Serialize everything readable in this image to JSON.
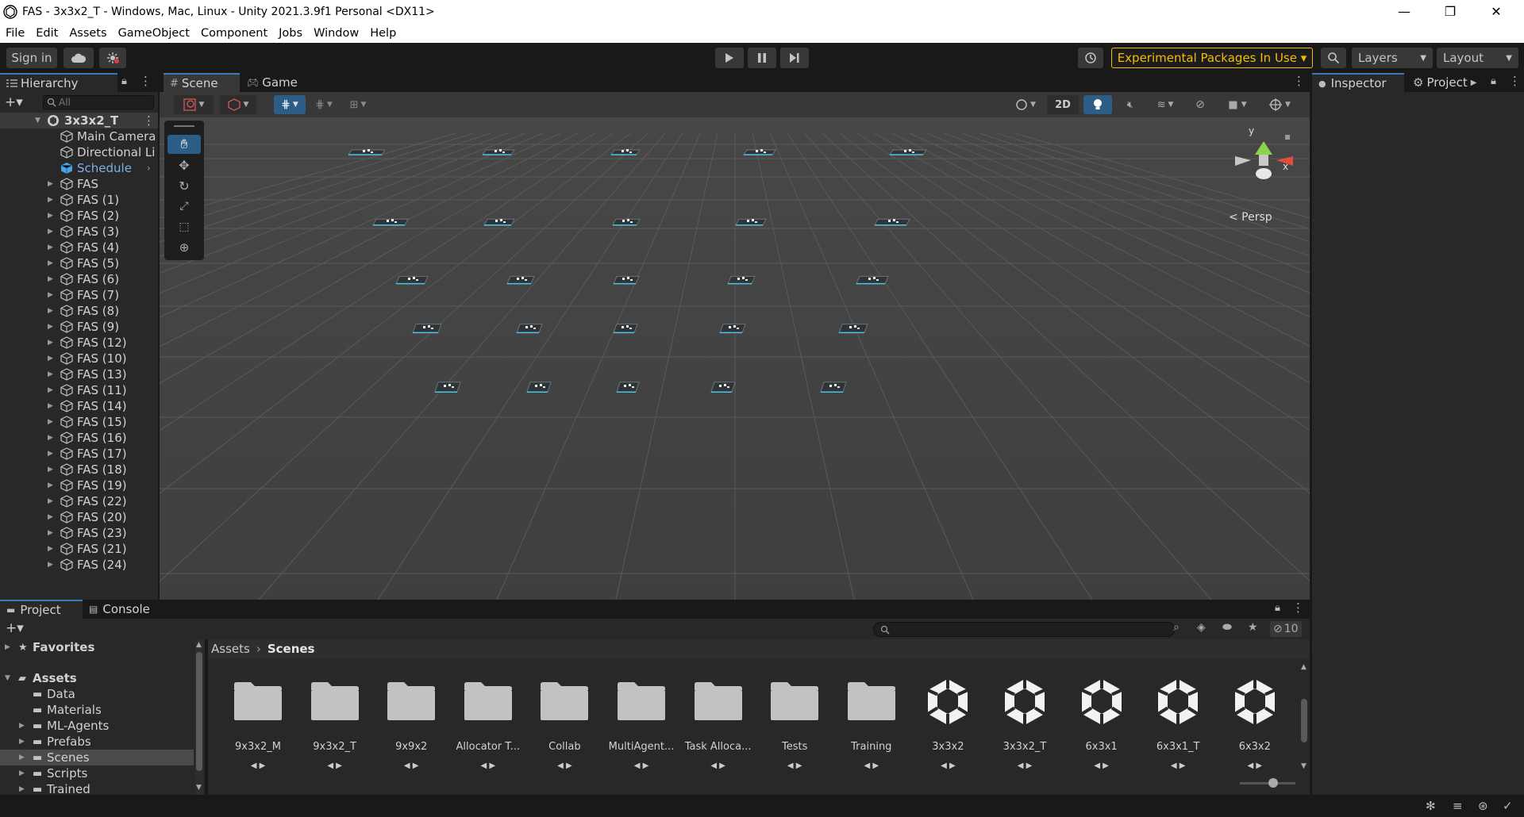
{
  "window": {
    "title": "FAS - 3x3x2_T - Windows, Mac, Linux - Unity 2021.3.9f1 Personal <DX11>",
    "minimize": "—",
    "maximize": "❐",
    "close": "✕"
  },
  "menu": [
    "File",
    "Edit",
    "Assets",
    "GameObject",
    "Component",
    "Jobs",
    "Window",
    "Help"
  ],
  "toolbar": {
    "sign_in": "Sign in",
    "experimental": "Experimental Packages In Use ▾",
    "layers": "Layers",
    "layout": "Layout"
  },
  "hierarchy": {
    "tab": "Hierarchy",
    "search_placeholder": "All",
    "scene_name": "3x3x2_T",
    "items": [
      {
        "label": "Main Camera",
        "expandable": false,
        "selected": false
      },
      {
        "label": "Directional Light",
        "expandable": false,
        "selected": false
      },
      {
        "label": "Schedule",
        "expandable": false,
        "selected": false,
        "highlight": true
      },
      {
        "label": "FAS",
        "expandable": true
      },
      {
        "label": "FAS (1)",
        "expandable": true
      },
      {
        "label": "FAS (2)",
        "expandable": true
      },
      {
        "label": "FAS (3)",
        "expandable": true
      },
      {
        "label": "FAS (4)",
        "expandable": true
      },
      {
        "label": "FAS (5)",
        "expandable": true
      },
      {
        "label": "FAS (6)",
        "expandable": true
      },
      {
        "label": "FAS (7)",
        "expandable": true
      },
      {
        "label": "FAS (8)",
        "expandable": true
      },
      {
        "label": "FAS (9)",
        "expandable": true
      },
      {
        "label": "FAS (12)",
        "expandable": true
      },
      {
        "label": "FAS (10)",
        "expandable": true
      },
      {
        "label": "FAS (13)",
        "expandable": true
      },
      {
        "label": "FAS (11)",
        "expandable": true
      },
      {
        "label": "FAS (14)",
        "expandable": true
      },
      {
        "label": "FAS (15)",
        "expandable": true
      },
      {
        "label": "FAS (16)",
        "expandable": true
      },
      {
        "label": "FAS (17)",
        "expandable": true
      },
      {
        "label": "FAS (18)",
        "expandable": true
      },
      {
        "label": "FAS (19)",
        "expandable": true
      },
      {
        "label": "FAS (22)",
        "expandable": true
      },
      {
        "label": "FAS (20)",
        "expandable": true
      },
      {
        "label": "FAS (23)",
        "expandable": true
      },
      {
        "label": "FAS (21)",
        "expandable": true
      },
      {
        "label": "FAS (24)",
        "expandable": true
      }
    ]
  },
  "scene": {
    "tabs": [
      "Scene",
      "Game"
    ],
    "btn_2d": "2D",
    "gizmo_y": "y",
    "gizmo_x": "x",
    "persp": "< Persp"
  },
  "inspector": {
    "tabs": [
      "Inspector",
      "Project"
    ]
  },
  "project": {
    "tabs": [
      "Project",
      "Console"
    ],
    "hidden_count": "10",
    "breadcrumb": [
      "Assets",
      "Scenes"
    ],
    "tree": [
      {
        "label": "Favorites",
        "level": 0,
        "icon": "star",
        "expandable": true,
        "bold": true
      },
      {
        "label": "Assets",
        "level": 0,
        "icon": "folder-open",
        "expandable": true,
        "bold": true,
        "expanded": true
      },
      {
        "label": "Data",
        "level": 1,
        "icon": "folder",
        "expandable": false
      },
      {
        "label": "Materials",
        "level": 1,
        "icon": "folder",
        "expandable": false
      },
      {
        "label": "ML-Agents",
        "level": 1,
        "icon": "folder",
        "expandable": true
      },
      {
        "label": "Prefabs",
        "level": 1,
        "icon": "folder",
        "expandable": true
      },
      {
        "label": "Scenes",
        "level": 1,
        "icon": "folder",
        "expandable": true,
        "selected": true
      },
      {
        "label": "Scripts",
        "level": 1,
        "icon": "folder",
        "expandable": true
      },
      {
        "label": "Trained",
        "level": 1,
        "icon": "folder",
        "expandable": true
      }
    ],
    "assets": [
      {
        "label": "9x3x2_M",
        "type": "folder"
      },
      {
        "label": "9x3x2_T",
        "type": "folder"
      },
      {
        "label": "9x9x2",
        "type": "folder"
      },
      {
        "label": "Allocator T...",
        "type": "folder"
      },
      {
        "label": "Collab",
        "type": "folder"
      },
      {
        "label": "MultiAgent...",
        "type": "folder"
      },
      {
        "label": "Task Alloca...",
        "type": "folder"
      },
      {
        "label": "Tests",
        "type": "folder"
      },
      {
        "label": "Training",
        "type": "folder"
      },
      {
        "label": "3x3x2",
        "type": "scene"
      },
      {
        "label": "3x3x2_T",
        "type": "scene"
      },
      {
        "label": "6x3x1",
        "type": "scene"
      },
      {
        "label": "6x3x1_T",
        "type": "scene"
      },
      {
        "label": "6x3x2",
        "type": "scene"
      }
    ]
  },
  "colors": {
    "accent_blue": "#2c5d87",
    "experimental_border": "#f4bc02",
    "experimental_text": "#f4bc02",
    "selected_row": "#2c5d87",
    "schedule_text": "#7cb0e8"
  }
}
